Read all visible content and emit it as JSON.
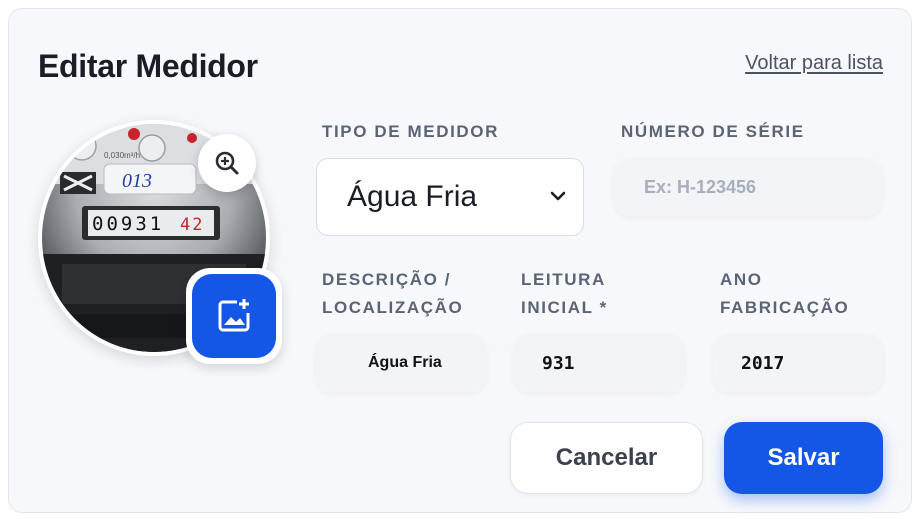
{
  "header": {
    "title": "Editar Medidor",
    "back_link": "Voltar para lista"
  },
  "photo": {
    "meter_label": "013",
    "meter_reading": "00931",
    "meter_reading_red": "42"
  },
  "form": {
    "tipo": {
      "label": "TIPO DE MEDIDOR",
      "value": "Água Fria"
    },
    "serie": {
      "label": "NÚMERO DE SÉRIE",
      "placeholder": "Ex: H-123456"
    },
    "descricao": {
      "label_line1": "DESCRIÇÃO /",
      "label_line2": "LOCALIZAÇÃO",
      "value": "Água Fria"
    },
    "leitura": {
      "label_line1": "LEITURA",
      "label_line2": "INICIAL *",
      "value": "931"
    },
    "ano": {
      "label_line1": "ANO",
      "label_line2": "FABRICAÇÃO",
      "value": "2017"
    }
  },
  "actions": {
    "cancel_label": "Cancelar",
    "save_label": "Salvar"
  },
  "colors": {
    "primary": "#1457e6",
    "background": "#f7f8fb",
    "text": "#1a1d26"
  },
  "icons": {
    "zoom": "zoom-in-icon",
    "upload": "add-image-icon",
    "chevron": "chevron-down-icon"
  }
}
